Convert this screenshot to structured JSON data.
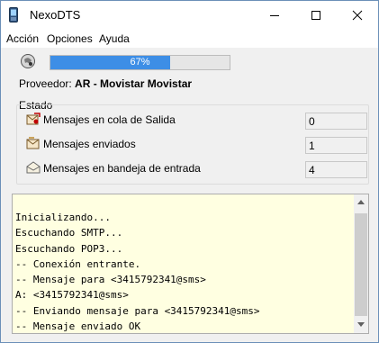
{
  "window": {
    "title": "NexoDTS"
  },
  "menu": [
    "Acción",
    "Opciones",
    "Ayuda"
  ],
  "progress": {
    "value": 0.67,
    "label": "67%"
  },
  "provider": {
    "label": "Proveedor:",
    "value": "AR - Movistar Movistar"
  },
  "estado": {
    "label": "Estado",
    "rows": [
      {
        "label": "Mensajes en cola de Salida",
        "value": "0",
        "icon": "outbox-icon"
      },
      {
        "label": "Mensajes enviados",
        "value": "1",
        "icon": "sent-mail-icon"
      },
      {
        "label": "Mensajes en bandeja de entrada",
        "value": "4",
        "icon": "inbox-icon"
      }
    ]
  },
  "log": {
    "lines": [
      "Inicializando...",
      "Escuchando SMTP...",
      "Escuchando POP3...",
      "-- Conexión entrante.",
      "-- Mensaje para <3415792341@sms>",
      "A: <3415792341@sms>",
      "-- Enviando mensaje para <3415792341@sms>",
      "-- Mensaje enviado OK"
    ]
  },
  "colors": {
    "progress_fill": "#3d8ee6",
    "log_background": "#ffffe1"
  }
}
